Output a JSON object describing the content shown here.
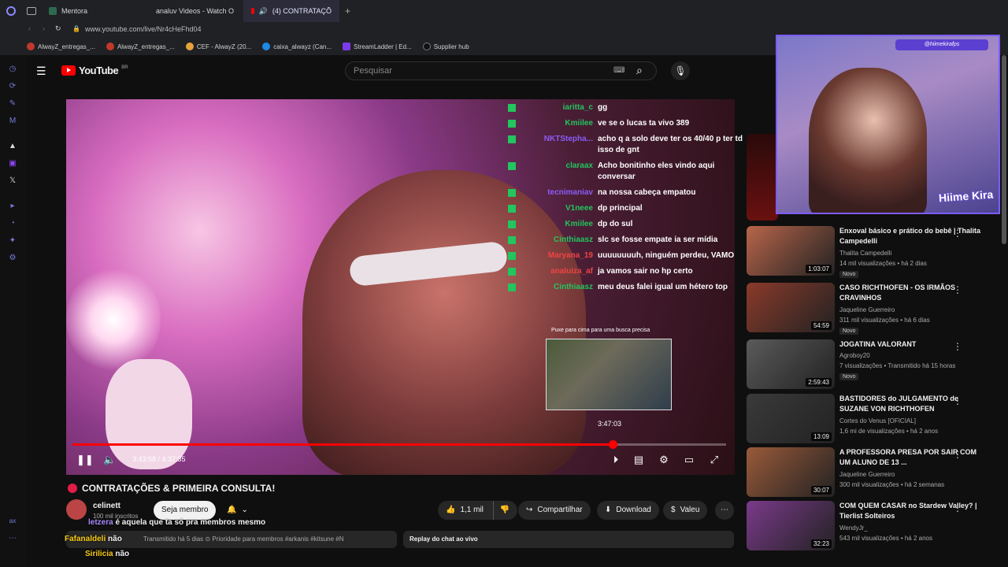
{
  "browser": {
    "tabs": [
      {
        "label": "Mentora"
      },
      {
        "label": "analuv Videos - Watch O"
      },
      {
        "label": "(4)  CONTRATAÇÕ"
      }
    ],
    "url": "www.youtube.com/live/Nr4cHeFhd04",
    "bookmarks": [
      {
        "label": "AlwayZ_entregas_..."
      },
      {
        "label": "AlwayZ_entregas_..."
      },
      {
        "label": "CEF - AlwayZ (20..."
      },
      {
        "label": "caixa_alwayz (Can..."
      },
      {
        "label": "StreamLadder | Ed..."
      },
      {
        "label": "Supplier hub"
      }
    ]
  },
  "youtube": {
    "logo_text": "YouTube",
    "region": "BR",
    "search_placeholder": "Pesquisar"
  },
  "chat_overlay": [
    {
      "user": "iaritta_c",
      "msg": "gg",
      "color": "#22c55e"
    },
    {
      "user": "Kmiilee",
      "msg": "ve se o lucas ta vivo 389",
      "color": "#22c55e"
    },
    {
      "user": "NKTStepha...",
      "msg": "acho q a solo deve ter os 40/40 p ter td isso de gnt",
      "color": "#8b5cf6"
    },
    {
      "user": "claraax",
      "msg": "Acho bonitinho eles vindo aqui conversar",
      "color": "#22c55e"
    },
    {
      "user": "tecnimaniav",
      "msg": "na nossa cabeça empatou",
      "color": "#8b5cf6"
    },
    {
      "user": "V1neee",
      "msg": "dp principal",
      "color": "#22c55e"
    },
    {
      "user": "Kmiilee",
      "msg": "dp do sul",
      "color": "#22c55e"
    },
    {
      "user": "Cinthiaasz",
      "msg": "slc se fosse empate ia ser mídia",
      "color": "#22c55e"
    },
    {
      "user": "Maryana_19",
      "msg": "uuuuuuuuh, ninguém perdeu, VAMO",
      "color": "#ef4444"
    },
    {
      "user": "analuiza_af",
      "msg": "ja vamos sair no hp certo",
      "color": "#ef4444"
    },
    {
      "user": "Cinthiaasz",
      "msg": "meu deus falei igual um hétero top",
      "color": "#22c55e"
    }
  ],
  "player": {
    "seek_hint": "Puxe para cima para uma busca precisa",
    "seek_time": "3:47:03",
    "time": "3:43:58 / 4:37:35",
    "progress": 0.826
  },
  "video": {
    "title": "CONTRATAÇÕES & PRIMEIRA CONSULTA!",
    "channel": "celinett",
    "subscribers": "100 mil inscritos",
    "member_button": "Seja membro",
    "likes": "1,1 mil",
    "share": "Compartilhar",
    "download": "Download",
    "thanks": "Valeu",
    "description": "Transmitido há 5 dias  ⊙ Prioridade para membros  #arkanis #kitsune #N",
    "chat_replay": "Replay do chat ao vivo"
  },
  "bottom_chat": [
    {
      "user": "letzera",
      "msg": "é aquela que ta só pra membros mesmo"
    },
    {
      "user": "Fafanaldeli",
      "msg": "não"
    },
    {
      "user": "Sirilicia",
      "msg": "não"
    }
  ],
  "webcam": {
    "handle": "@hiimekirafps",
    "brand": "Hiime Kira"
  },
  "recommendations": [
    {
      "title": "Enxoval básico e prático do bebê | Thalita Campedelli",
      "channel": "Thalita Campedelli",
      "meta": "14 mil visualizações • há 2 dias",
      "badge": "Novo",
      "duration": "1:03:07",
      "color": "#b8654a"
    },
    {
      "title": "CASO RICHTHOFEN - OS IRMÃOS CRAVINHOS",
      "channel": "Jaqueline Guerreiro",
      "meta": "311 mil visualizações • há 6 dias",
      "badge": "Novo",
      "duration": "54:59",
      "color": "#8a3a2a"
    },
    {
      "title": "JOGATINA VALORANT",
      "channel": "Agroboy20",
      "meta": "7 visualizações • Transmitido há 15 horas",
      "badge": "Novo",
      "duration": "2:59:43",
      "color": "#5a5a5a"
    },
    {
      "title": "BASTIDORES do JULGAMENTO de SUZANE VON RICHTHOFEN",
      "channel": "Cortes do Venus [OFICIAL]",
      "meta": "1,6 mi de visualizações • há 2 anos",
      "badge": "",
      "duration": "13:09",
      "color": "#3a3a3a"
    },
    {
      "title": "A PROFESSORA PRESA POR SAIR COM UM ALUNO DE 13 ...",
      "channel": "Jaqueline Guerreiro",
      "meta": "300 mil visualizações • há 2 semanas",
      "badge": "",
      "duration": "30:07",
      "color": "#9a5a3a"
    },
    {
      "title": "COM QUEM CASAR no Stardew Valley? | Tierlist Solteiros",
      "channel": "WendyJr_",
      "meta": "543 mil visualizações • há 2 anos",
      "badge": "",
      "duration": "32:23",
      "color": "#7a3a8a"
    }
  ]
}
